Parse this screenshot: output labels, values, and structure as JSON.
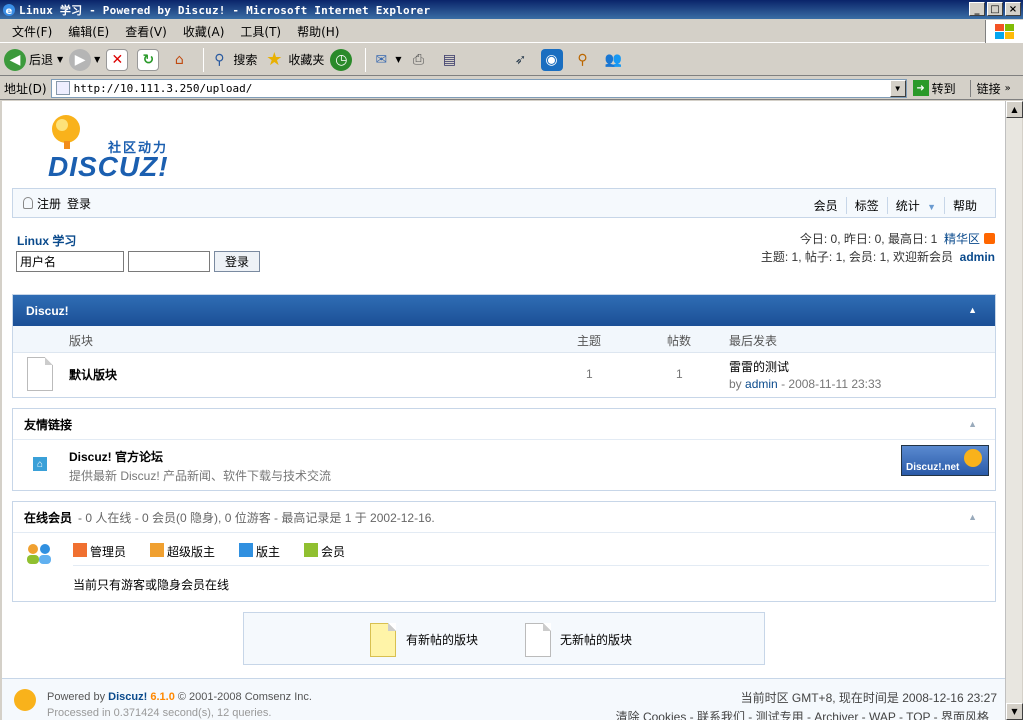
{
  "window": {
    "title": "Linux 学习 - Powered by Discuz! - Microsoft Internet Explorer",
    "btn_min": "_",
    "btn_max": "□",
    "btn_close": "×"
  },
  "menu": [
    "文件(F)",
    "编辑(E)",
    "查看(V)",
    "收藏(A)",
    "工具(T)",
    "帮助(H)"
  ],
  "toolbar": {
    "back": "后退",
    "search": "搜索",
    "favorites": "收藏夹"
  },
  "address": {
    "label": "地址(D)",
    "url": "http://10.111.3.250/upload/",
    "goto": "转到",
    "links": "链接"
  },
  "logo": {
    "cn": "社区动力",
    "en": "DISCUZ!"
  },
  "nav": {
    "register": "注册",
    "login": "登录",
    "right": [
      "会员",
      "标签",
      "统计",
      "帮助"
    ]
  },
  "forum_title": "Linux 学习",
  "login_form": {
    "username_value": "用户名",
    "password_value": "",
    "submit": "登录"
  },
  "stats": {
    "today_label": "今日:",
    "today": "0",
    "yesterday_label": "昨日:",
    "yesterday": "0",
    "max_label": "最高日:",
    "max": "1",
    "digest": "精华区",
    "threads_label": "主题:",
    "threads": "1",
    "posts_label": "帖子:",
    "posts": "1",
    "members_label": "会员:",
    "members": "1",
    "welcome": "欢迎新会员",
    "newest": "admin"
  },
  "category": {
    "name": "Discuz!",
    "columns": {
      "forum": "版块",
      "threads": "主题",
      "posts": "帖数",
      "lastpost": "最后发表"
    },
    "forums": [
      {
        "name": "默认版块",
        "threads": "1",
        "posts": "1",
        "last_title": "雷雷的测试",
        "by_label": "by",
        "last_author": "admin",
        "last_time": "- 2008-11-11 23:33"
      }
    ]
  },
  "friendlinks": {
    "title": "友情链接",
    "items": [
      {
        "name": "Discuz! 官方论坛",
        "desc": "提供最新 Discuz! 产品新闻、软件下载与技术交流",
        "banner": "Discuz!.net"
      }
    ]
  },
  "online": {
    "title": "在线会员",
    "summary": "- 0 人在线 - 0 会员(0 隐身), 0 位游客 - 最高记录是 1 于 2002-12-16.",
    "legend": [
      "管理员",
      "超级版主",
      "版主",
      "会员"
    ],
    "legend_colors": [
      "#f07030",
      "#f0a030",
      "#3090e0",
      "#90c030"
    ],
    "note": "当前只有游客或隐身会员在线"
  },
  "legend_box": {
    "new": "有新帖的版块",
    "nonew": "无新帖的版块"
  },
  "footer": {
    "powered_prefix": "Powered by",
    "product": "Discuz!",
    "version": "6.1.0",
    "copyright": "© 2001-2008 Comsenz Inc.",
    "processed": "Processed in 0.371424 second(s), 12 queries.",
    "timezone": "当前时区 GMT+8, 现在时间是 2008-12-16 23:27",
    "links": "清除 Cookies - 联系我们 - 测试专用 - Archiver - WAP - TOP - 界面风格"
  }
}
